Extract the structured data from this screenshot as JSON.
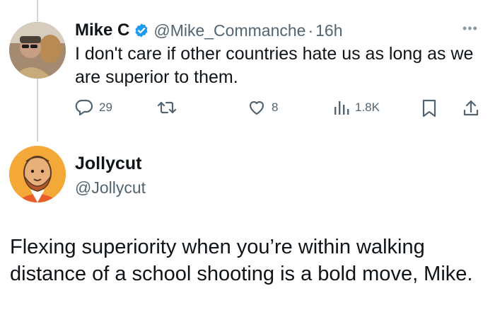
{
  "tweet1": {
    "name": "Mike C",
    "handle": "@Mike_Commanche",
    "separator": "·",
    "time": "16h",
    "text": "I don't care if other countries hate us as long as we are superior to them.",
    "more": "•••",
    "actions": {
      "reply_count": "29",
      "retweet_count": "",
      "like_count": "8",
      "views_count": "1.8K"
    }
  },
  "tweet2": {
    "name": "Jollycut",
    "handle": "@Jollycut",
    "text": "Flexing superiority when you’re within walking distance of a school shooting is a bold move, Mike."
  },
  "colors": {
    "verified": "#1d9bf0",
    "text": "#0f1419",
    "secondary": "#536471",
    "thread_line": "#cfd9de"
  },
  "icons": [
    "verified-badge-icon",
    "more-icon",
    "reply-icon",
    "retweet-icon",
    "like-icon",
    "views-icon",
    "bookmark-icon",
    "share-icon"
  ]
}
